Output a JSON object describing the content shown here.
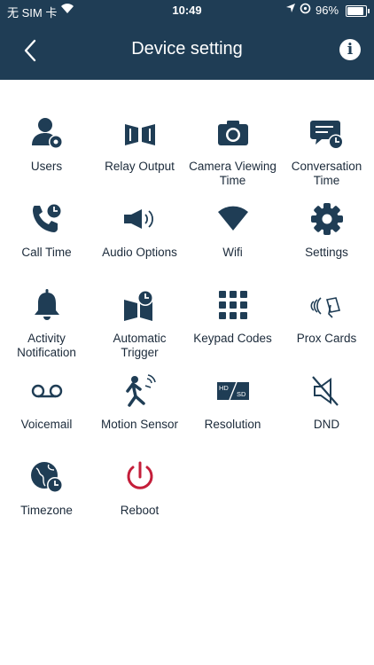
{
  "statusbar": {
    "carrier": "无 SIM 卡",
    "time": "10:49",
    "battery": "96%"
  },
  "header": {
    "title": "Device setting",
    "back_icon": "chevron-left-icon",
    "info_icon": "info-icon"
  },
  "colors": {
    "header_bg": "#1f3d55",
    "icon": "#1f3d55",
    "reboot_accent": "#c41e3a"
  },
  "tiles": [
    {
      "label": "Users",
      "icon": "user-gear-icon"
    },
    {
      "label": "Relay Output",
      "icon": "gate-icon"
    },
    {
      "label": "Camera Viewing Time",
      "icon": "camera-icon"
    },
    {
      "label": "Conversation Time",
      "icon": "chat-clock-icon"
    },
    {
      "label": "Call Time",
      "icon": "phone-clock-icon"
    },
    {
      "label": "Audio Options",
      "icon": "speaker-icon"
    },
    {
      "label": "Wifi",
      "icon": "wifi-icon"
    },
    {
      "label": "Settings",
      "icon": "gear-icon"
    },
    {
      "label": "Activity Notification",
      "icon": "bell-icon"
    },
    {
      "label": "Automatic Trigger",
      "icon": "gate-clock-icon"
    },
    {
      "label": "Keypad Codes",
      "icon": "keypad-icon"
    },
    {
      "label": "Prox Cards",
      "icon": "contactless-card-icon"
    },
    {
      "label": "Voicemail",
      "icon": "voicemail-icon"
    },
    {
      "label": "Motion Sensor",
      "icon": "motion-icon"
    },
    {
      "label": "Resolution",
      "icon": "hd-sd-icon"
    },
    {
      "label": "DND",
      "icon": "mute-icon"
    },
    {
      "label": "Timezone",
      "icon": "globe-clock-icon"
    },
    {
      "label": "Reboot",
      "icon": "power-icon"
    }
  ]
}
